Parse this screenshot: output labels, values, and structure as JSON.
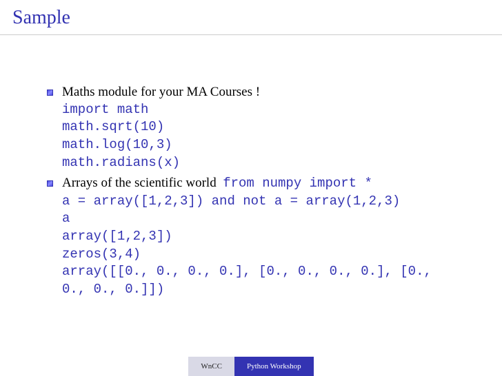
{
  "title": "Sample",
  "bullets": [
    {
      "text": "Maths module for your MA Courses !",
      "code": "import math\nmath.sqrt(10)\nmath.log(10,3)\nmath.radians(x)"
    },
    {
      "text": "Arrays of the scientific world",
      "inline_code": "from numpy import *",
      "code": "a = array([1,2,3]) and not a = array(1,2,3)\na\narray([1,2,3])\nzeros(3,4)\narray([[0., 0., 0., 0.], [0., 0., 0., 0.], [0.,\n0., 0., 0.]])"
    }
  ],
  "footer": {
    "author": "WnCC",
    "title": "Python Workshop"
  }
}
